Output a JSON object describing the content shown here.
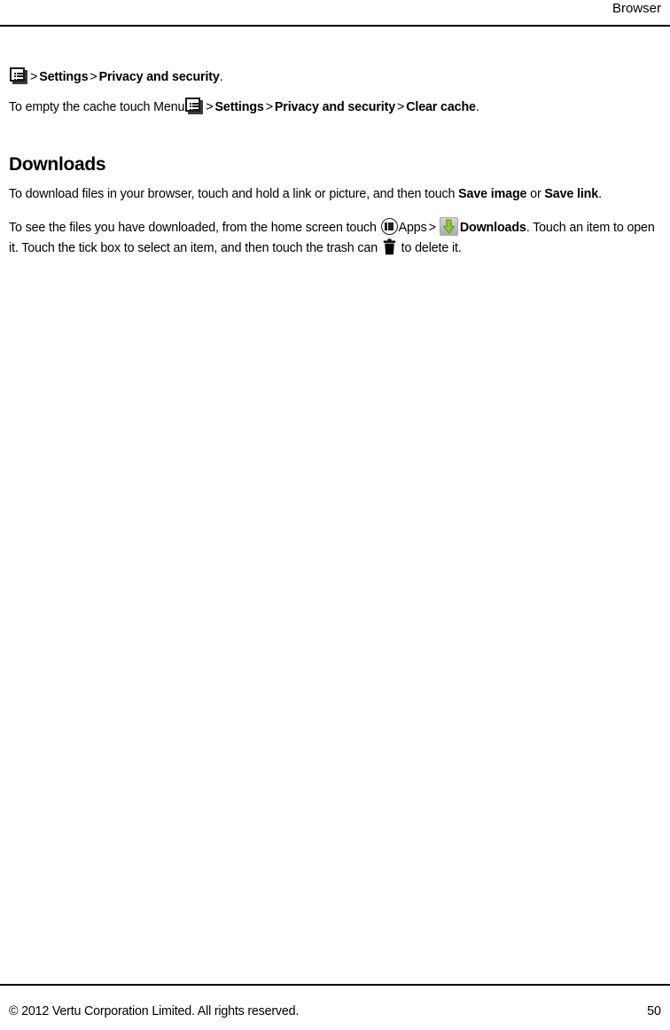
{
  "header": {
    "title": "Browser"
  },
  "content": {
    "breadcrumb_line": {
      "menu_icon": "menu-list-icon",
      "sep1": ">",
      "settings": "Settings",
      "sep2": ">",
      "privacy": "Privacy and security",
      "period": "."
    },
    "cache_line": {
      "lead": "To empty the cache touch Menu",
      "menu_icon": "menu-list-icon",
      "sep1": ">",
      "settings": "Settings",
      "sep2": ">",
      "privacy": "Privacy and security",
      "sep3": ">",
      "clear_cache": "Clear cache",
      "period": "."
    },
    "downloads_heading": "Downloads",
    "download_para": {
      "part1": "To download files in your browser, touch and hold a link or picture, and then touch ",
      "save_image": "Save image",
      "part2": " or ",
      "save_link": "Save link",
      "period": "."
    },
    "see_files_para": {
      "part1": "To see the files you have downloaded, from the home screen touch ",
      "apps_icon": "apps-grid-icon",
      "apps_label": "Apps",
      "sep1": ">",
      "downloads_icon": "downloads-arrow-icon",
      "downloads_label": "Downloads",
      "part2": ". Touch an item to open it. Touch the tick box to select an item, and then touch the trash can ",
      "trash_icon": "trash-can-icon",
      "part3": " to delete it."
    }
  },
  "footer": {
    "copyright": "© 2012 Vertu Corporation Limited. All rights reserved.",
    "page_number": "50"
  },
  "colors": {
    "text": "#000000",
    "rule": "#000000",
    "arrow_green_light": "#8cc63f",
    "arrow_green_dark": "#5f9c1e",
    "icon_plate": "#c2c2c2"
  }
}
